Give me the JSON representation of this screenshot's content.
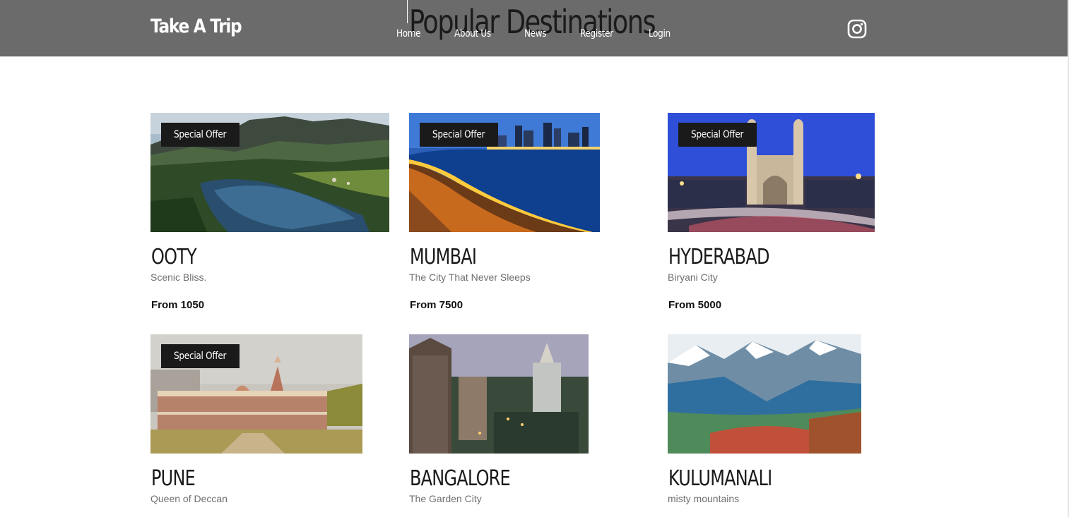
{
  "header": {
    "brand": "Take A Trip",
    "page_title": "Popular Destinations",
    "nav": [
      "Home",
      "About Us",
      "News",
      "Register",
      "Login"
    ],
    "social_icon": "instagram-icon"
  },
  "destinations": [
    {
      "name": "OOTY",
      "tagline": "Scenic Bliss.",
      "price": "From 1050",
      "badge": "Special Offer"
    },
    {
      "name": "MUMBAI",
      "tagline": "The City That Never Sleeps",
      "price": "From 7500",
      "badge": "Special Offer"
    },
    {
      "name": "HYDERABAD",
      "tagline": "Biryani City",
      "price": "From 5000",
      "badge": "Special Offer"
    },
    {
      "name": "PUNE",
      "tagline": "Queen of Deccan",
      "badge": "Special Offer"
    },
    {
      "name": "BANGALORE",
      "tagline": "The Garden City"
    },
    {
      "name": "KULUMANALI",
      "tagline": "misty mountains"
    }
  ],
  "colors": {
    "header_bg": "#6b6b6b",
    "badge_bg": "#1a1a1a",
    "tagline": "#6f6f6f"
  }
}
